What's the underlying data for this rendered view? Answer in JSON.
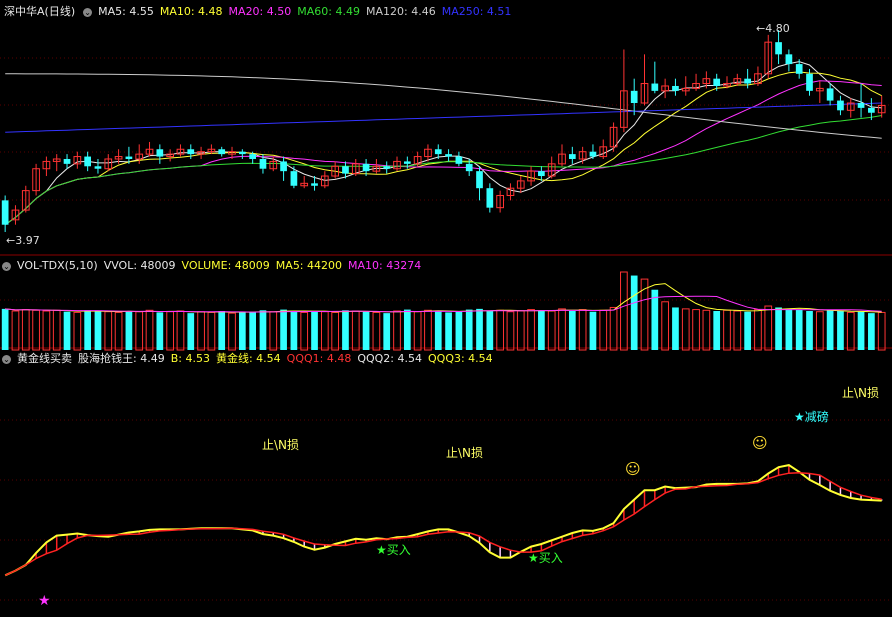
{
  "panels": {
    "price": {
      "title": "深中华A(日线)",
      "indicators": [
        {
          "label": "MA5: 4.55",
          "color": "#e8e8e8"
        },
        {
          "label": "MA10: 4.48",
          "color": "#ffff33"
        },
        {
          "label": "MA20: 4.50",
          "color": "#ff33ff"
        },
        {
          "label": "MA60: 4.49",
          "color": "#33dd33"
        },
        {
          "label": "MA120: 4.46",
          "color": "#cccccc"
        },
        {
          "label": "MA250: 4.51",
          "color": "#3333ff"
        }
      ],
      "high_label": "4.80",
      "low_label": "3.97"
    },
    "volume": {
      "title": "VOL-TDX(5,10)",
      "indicators": [
        {
          "label": "VVOL: 48009",
          "color": "#e8e8e8"
        },
        {
          "label": "VOLUME: 48009",
          "color": "#ffff33"
        },
        {
          "label": "MA5: 44200",
          "color": "#ffff33"
        },
        {
          "label": "MA10: 43274",
          "color": "#ff33ff"
        }
      ]
    },
    "gold": {
      "title": "黄金线买卖",
      "indicators": [
        {
          "label": "股海抢钱王: 4.49",
          "color": "#e8e8e8"
        },
        {
          "label": "B: 4.53",
          "color": "#ffff33"
        },
        {
          "label": "黄金线: 4.54",
          "color": "#ffff33"
        },
        {
          "label": "QQQ1: 4.48",
          "color": "#ff3333"
        },
        {
          "label": "QQQ2: 4.54",
          "color": "#e8e8e8"
        },
        {
          "label": "QQQ3: 4.54",
          "color": "#ffff33"
        }
      ],
      "signals": {
        "stop1": "止\\N损",
        "stop2": "止\\N损",
        "stop3": "止\\N损",
        "reduce": "★减磅",
        "buy1": "★买入",
        "buy2": "★买入"
      }
    }
  },
  "chart_data": {
    "type": "candlestick",
    "ylim": [
      3.97,
      4.8
    ],
    "candles": [
      [
        4.1,
        4.0,
        4.12,
        3.97
      ],
      [
        4.02,
        4.06,
        4.08,
        4.0
      ],
      [
        4.06,
        4.14,
        4.16,
        4.05
      ],
      [
        4.14,
        4.23,
        4.25,
        4.12
      ],
      [
        4.23,
        4.26,
        4.28,
        4.2
      ],
      [
        4.26,
        4.27,
        4.29,
        4.22
      ],
      [
        4.27,
        4.25,
        4.29,
        4.23
      ],
      [
        4.25,
        4.28,
        4.3,
        4.23
      ],
      [
        4.28,
        4.24,
        4.3,
        4.22
      ],
      [
        4.24,
        4.23,
        4.27,
        4.21
      ],
      [
        4.23,
        4.27,
        4.29,
        4.22
      ],
      [
        4.27,
        4.28,
        4.31,
        4.25
      ],
      [
        4.28,
        4.27,
        4.32,
        4.25
      ],
      [
        4.27,
        4.29,
        4.33,
        4.25
      ],
      [
        4.29,
        4.31,
        4.34,
        4.28
      ],
      [
        4.31,
        4.28,
        4.33,
        4.25
      ],
      [
        4.28,
        4.29,
        4.31,
        4.26
      ],
      [
        4.29,
        4.31,
        4.33,
        4.28
      ],
      [
        4.31,
        4.29,
        4.33,
        4.27
      ],
      [
        4.29,
        4.3,
        4.32,
        4.27
      ],
      [
        4.3,
        4.31,
        4.33,
        4.29
      ],
      [
        4.31,
        4.29,
        4.32,
        4.28
      ],
      [
        4.29,
        4.3,
        4.32,
        4.27
      ],
      [
        4.3,
        4.29,
        4.31,
        4.27
      ],
      [
        4.29,
        4.27,
        4.3,
        4.25
      ],
      [
        4.27,
        4.23,
        4.29,
        4.21
      ],
      [
        4.23,
        4.26,
        4.28,
        4.22
      ],
      [
        4.26,
        4.22,
        4.28,
        4.18
      ],
      [
        4.22,
        4.16,
        4.24,
        4.15
      ],
      [
        4.16,
        4.17,
        4.2,
        4.15
      ],
      [
        4.17,
        4.16,
        4.2,
        4.14
      ],
      [
        4.16,
        4.2,
        4.22,
        4.15
      ],
      [
        4.2,
        4.24,
        4.26,
        4.19
      ],
      [
        4.24,
        4.21,
        4.26,
        4.19
      ],
      [
        4.21,
        4.25,
        4.27,
        4.2
      ],
      [
        4.25,
        4.22,
        4.27,
        4.2
      ],
      [
        4.22,
        4.24,
        4.27,
        4.21
      ],
      [
        4.24,
        4.23,
        4.26,
        4.21
      ],
      [
        4.23,
        4.26,
        4.28,
        4.22
      ],
      [
        4.26,
        4.25,
        4.28,
        4.23
      ],
      [
        4.25,
        4.28,
        4.3,
        4.24
      ],
      [
        4.28,
        4.31,
        4.33,
        4.26
      ],
      [
        4.31,
        4.29,
        4.33,
        4.27
      ],
      [
        4.29,
        4.28,
        4.31,
        4.26
      ],
      [
        4.28,
        4.25,
        4.3,
        4.24
      ],
      [
        4.25,
        4.22,
        4.27,
        4.2
      ],
      [
        4.22,
        4.15,
        4.24,
        4.1
      ],
      [
        4.15,
        4.07,
        4.17,
        4.05
      ],
      [
        4.07,
        4.12,
        4.14,
        4.05
      ],
      [
        4.12,
        4.15,
        4.17,
        4.1
      ],
      [
        4.15,
        4.18,
        4.2,
        4.13
      ],
      [
        4.18,
        4.22,
        4.24,
        4.16
      ],
      [
        4.22,
        4.2,
        4.24,
        4.18
      ],
      [
        4.2,
        4.25,
        4.28,
        4.19
      ],
      [
        4.25,
        4.29,
        4.33,
        4.24
      ],
      [
        4.29,
        4.27,
        4.32,
        4.25
      ],
      [
        4.27,
        4.3,
        4.32,
        4.25
      ],
      [
        4.3,
        4.28,
        4.33,
        4.27
      ],
      [
        4.28,
        4.32,
        4.35,
        4.27
      ],
      [
        4.32,
        4.4,
        4.42,
        4.3
      ],
      [
        4.4,
        4.55,
        4.72,
        4.38
      ],
      [
        4.55,
        4.5,
        4.6,
        4.45
      ],
      [
        4.5,
        4.58,
        4.7,
        4.49
      ],
      [
        4.58,
        4.55,
        4.67,
        4.54
      ],
      [
        4.55,
        4.57,
        4.6,
        4.52
      ],
      [
        4.57,
        4.55,
        4.6,
        4.53
      ],
      [
        4.55,
        4.56,
        4.61,
        4.53
      ],
      [
        4.56,
        4.58,
        4.62,
        4.55
      ],
      [
        4.58,
        4.6,
        4.63,
        4.56
      ],
      [
        4.6,
        4.57,
        4.62,
        4.55
      ],
      [
        4.57,
        4.58,
        4.61,
        4.56
      ],
      [
        4.58,
        4.6,
        4.62,
        4.57
      ],
      [
        4.6,
        4.58,
        4.64,
        4.56
      ],
      [
        4.58,
        4.62,
        4.65,
        4.57
      ],
      [
        4.62,
        4.75,
        4.78,
        4.6
      ],
      [
        4.75,
        4.7,
        4.8,
        4.66
      ],
      [
        4.7,
        4.66,
        4.72,
        4.63
      ],
      [
        4.66,
        4.62,
        4.68,
        4.6
      ],
      [
        4.62,
        4.55,
        4.64,
        4.53
      ],
      [
        4.55,
        4.56,
        4.59,
        4.5
      ],
      [
        4.56,
        4.51,
        4.58,
        4.49
      ],
      [
        4.51,
        4.47,
        4.53,
        4.45
      ],
      [
        4.47,
        4.5,
        4.52,
        4.44
      ],
      [
        4.5,
        4.48,
        4.58,
        4.44
      ],
      [
        4.48,
        4.46,
        4.52,
        4.43
      ],
      [
        4.46,
        4.49,
        4.53,
        4.44
      ]
    ],
    "volumes": [
      58,
      55,
      57,
      56,
      55,
      56,
      54,
      53,
      56,
      55,
      54,
      53,
      55,
      54,
      56,
      53,
      54,
      55,
      52,
      54,
      53,
      55,
      52,
      54,
      53,
      56,
      54,
      57,
      55,
      53,
      55,
      54,
      53,
      56,
      55,
      54,
      53,
      52,
      55,
      57,
      54,
      56,
      55,
      53,
      54,
      57,
      58,
      55,
      56,
      54,
      55,
      57,
      56,
      55,
      58,
      55,
      57,
      54,
      56,
      60,
      110,
      105,
      100,
      85,
      68,
      60,
      58,
      57,
      56,
      55,
      56,
      55,
      54,
      57,
      62,
      60,
      58,
      57,
      55,
      54,
      56,
      55,
      53,
      54,
      52,
      53
    ]
  }
}
